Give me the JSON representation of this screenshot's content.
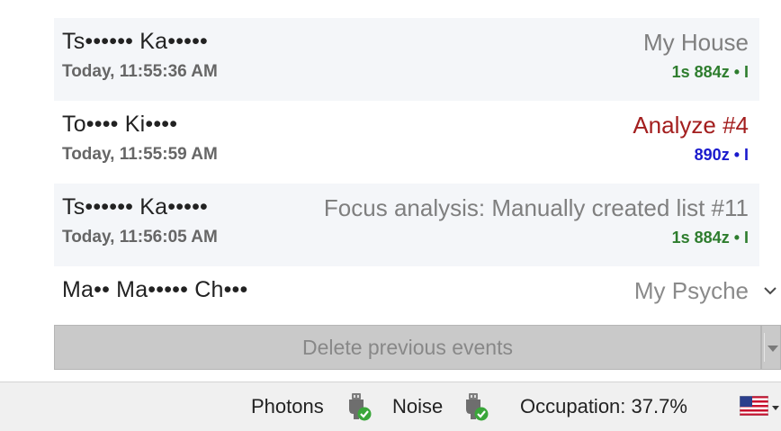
{
  "events": [
    {
      "name": "Ts•••••• Ka•••••",
      "time": "Today, 11:55:36 AM",
      "title": "My House",
      "title_color": "#7f7f7f",
      "meta": "1s 884z • I",
      "meta_color": "#2e7d2e"
    },
    {
      "name": "To•••• Ki••••",
      "time": "Today, 11:55:59 AM",
      "title": "Analyze #4",
      "title_color": "#a31e1e",
      "meta": "890z • I",
      "meta_color": "#1a1acd"
    },
    {
      "name": "Ts•••••• Ka•••••",
      "time": "Today, 11:56:05 AM",
      "title": "Focus analysis: Manually created list #11",
      "title_color": "#7f7f7f",
      "meta": "1s 884z • I",
      "meta_color": "#2e7d2e"
    },
    {
      "name": "Ma•• Ma••••• Ch•••",
      "title": "My Psyche",
      "title_color": "#8a8a8a"
    }
  ],
  "actions": {
    "delete_previous": "Delete previous events"
  },
  "status": {
    "photons_label": "Photons",
    "noise_label": "Noise",
    "occupation": "Occupation: 37.7%"
  }
}
